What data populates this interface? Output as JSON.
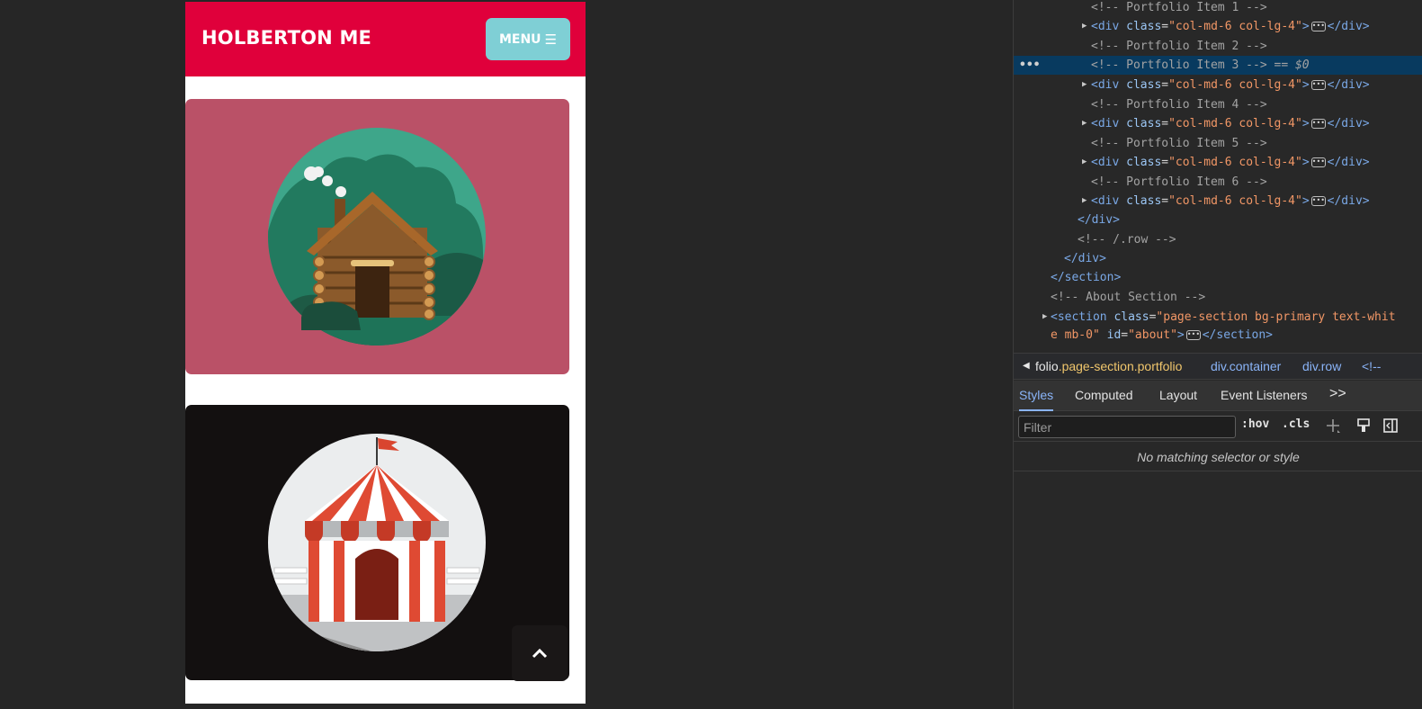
{
  "site": {
    "brand": "HOLBERTON ME",
    "menu_label": "MENU",
    "menu_icon": "bars-icon",
    "portfolio_items": [
      {
        "name": "cabin",
        "bg_color": "#ba5167",
        "illustration": "log-cabin-icon"
      },
      {
        "name": "circus",
        "bg_color": "#131010",
        "illustration": "circus-tent-icon"
      }
    ],
    "scroll_top_icon": "chevron-up-icon",
    "colors": {
      "navbar": "#e0003b",
      "menu_button": "#7fcfd5"
    }
  },
  "devtools": {
    "dom_lines": [
      {
        "text": "<!-- Portfolio Item 1 -->"
      },
      {
        "tag": "div",
        "attr": "class",
        "value": "col-md-6 col-lg-4"
      },
      {
        "text": "<!-- Portfolio Item 2 -->"
      },
      {
        "text": "<!-- Portfolio Item 3 -->",
        "suffix": "== $0",
        "dots": "•••"
      },
      {
        "tag": "div",
        "attr": "class",
        "value": "col-md-6 col-lg-4"
      },
      {
        "text": "<!-- Portfolio Item 4 -->"
      },
      {
        "tag": "div",
        "attr": "class",
        "value": "col-md-6 col-lg-4"
      },
      {
        "text": "<!-- Portfolio Item 5 -->"
      },
      {
        "tag": "div",
        "attr": "class",
        "value": "col-md-6 col-lg-4"
      },
      {
        "text": "<!-- Portfolio Item 6 -->"
      },
      {
        "tag": "div",
        "attr": "class",
        "value": "col-md-6 col-lg-4"
      },
      {
        "text": "</div>"
      },
      {
        "text": "<!-- /.row -->"
      },
      {
        "text": "</div>"
      },
      {
        "text": "</section>"
      },
      {
        "text": "<!-- About Section -->"
      },
      {
        "tag": "section",
        "attr": "class",
        "value": "page-section bg-primary text-whit",
        "open_only": true
      },
      {
        "cont_val": "e mb-0",
        "attr2": "id",
        "value2": "about",
        "close": "</section>"
      }
    ],
    "breadcrumbs": {
      "first_tag": "folio",
      "first_class": ".page-section.portfolio",
      "second": "div.container",
      "third": "div.row",
      "fourth": "<!--",
      "arrow": "◀"
    },
    "tabs": [
      "Styles",
      "Computed",
      "Layout",
      "Event Listeners"
    ],
    "tabs_more": ">>",
    "filter_placeholder": "Filter",
    "hov_label": ":hov",
    "cls_label": ".cls",
    "empty_message": "No matching selector or style",
    "ellipsis": "•••"
  }
}
